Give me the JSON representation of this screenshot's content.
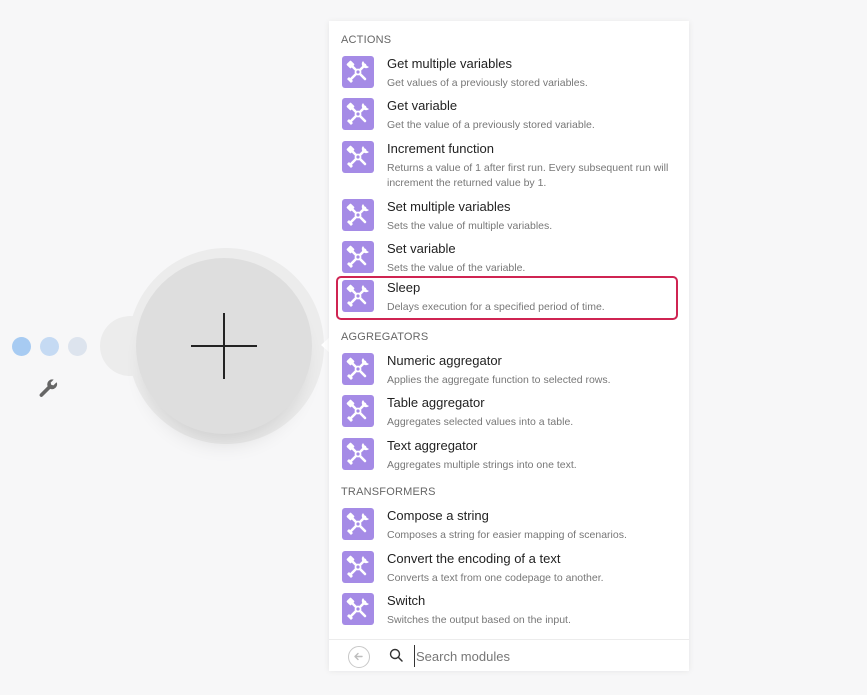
{
  "canvas": {
    "dots_colors": [
      "#a7cbf2",
      "#c5daf3",
      "#dde4ee"
    ],
    "wrench_icon": "wrench-icon",
    "add_module_icon": "plus-icon"
  },
  "colors": {
    "accent_icon": "#a58be6",
    "highlight_border": "#cf2452"
  },
  "panel": {
    "sections": [
      {
        "title": "ACTIONS",
        "items": [
          {
            "title": "Get multiple variables",
            "desc": "Get values of a previously stored variables."
          },
          {
            "title": "Get variable",
            "desc": "Get the value of a previously stored variable."
          },
          {
            "title": "Increment function",
            "desc": "Returns a value of 1 after first run. Every subsequent run will increment the returned value by 1."
          },
          {
            "title": "Set multiple variables",
            "desc": "Sets the value of multiple variables."
          },
          {
            "title": "Set variable",
            "desc": "Sets the value of the variable."
          },
          {
            "title": "Sleep",
            "desc": "Delays execution for a specified period of time."
          }
        ]
      },
      {
        "title": "AGGREGATORS",
        "items": [
          {
            "title": "Numeric aggregator",
            "desc": "Applies the aggregate function to selected rows."
          },
          {
            "title": "Table aggregator",
            "desc": "Aggregates selected values into a table."
          },
          {
            "title": "Text aggregator",
            "desc": "Aggregates multiple strings into one text."
          }
        ]
      },
      {
        "title": "TRANSFORMERS",
        "items": [
          {
            "title": "Compose a string",
            "desc": "Composes a string for easier mapping of scenarios."
          },
          {
            "title": "Convert the encoding of a text",
            "desc": "Converts a text from one codepage to another."
          },
          {
            "title": "Switch",
            "desc": "Switches the output based on the input."
          }
        ]
      }
    ],
    "item_icon": "tools-icon",
    "selected_item": "Sleep"
  },
  "footer": {
    "back_icon": "arrow-left-icon",
    "search_icon": "search-icon",
    "search_placeholder": "Search modules",
    "search_value": ""
  }
}
